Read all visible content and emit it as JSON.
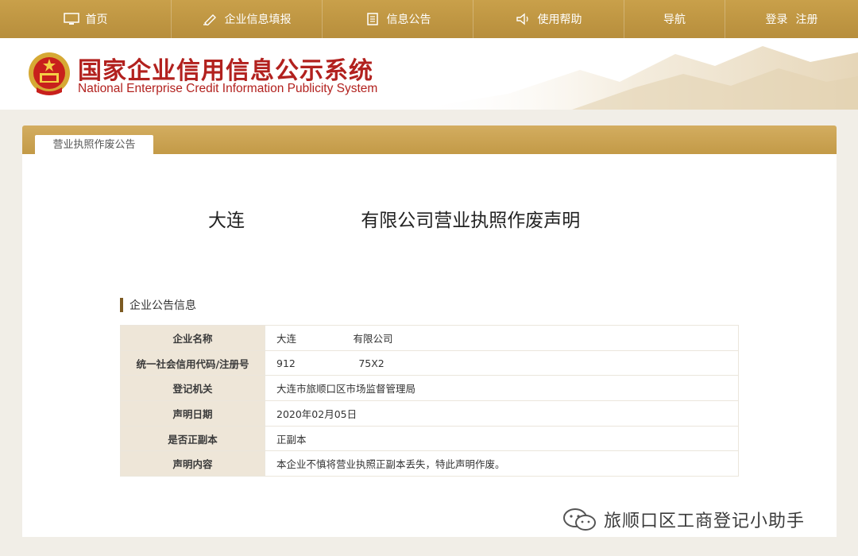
{
  "nav": {
    "home": "首页",
    "report": "企业信息填报",
    "notice": "信息公告",
    "help": "使用帮助",
    "guide": "导航",
    "login": "登录",
    "register": "注册"
  },
  "header": {
    "title_cn": "国家企业信用信息公示系统",
    "title_en": "National Enterprise Credit Information Publicity System"
  },
  "panel": {
    "tab_label": "营业执照作废公告",
    "notice_title": "大连                    有限公司营业执照作废声明"
  },
  "section": {
    "label": "企业公告信息"
  },
  "info_rows": [
    {
      "key": "企业名称",
      "value": "大连                  有限公司"
    },
    {
      "key": "统一社会信用代码/注册号",
      "value": "912                    75X2"
    },
    {
      "key": "登记机关",
      "value": "大连市旅顺口区市场监督管理局"
    },
    {
      "key": "声明日期",
      "value": "2020年02月05日"
    },
    {
      "key": "是否正副本",
      "value": "正副本"
    },
    {
      "key": "声明内容",
      "value": "本企业不慎将营业执照正副本丢失，特此声明作废。"
    }
  ],
  "watermark": {
    "text": "旅顺口区工商登记小助手"
  },
  "colors": {
    "nav_gold": "#c09648",
    "title_red": "#b2211e",
    "label_bg": "#eee6d8",
    "section_bar": "#7c5a22"
  }
}
